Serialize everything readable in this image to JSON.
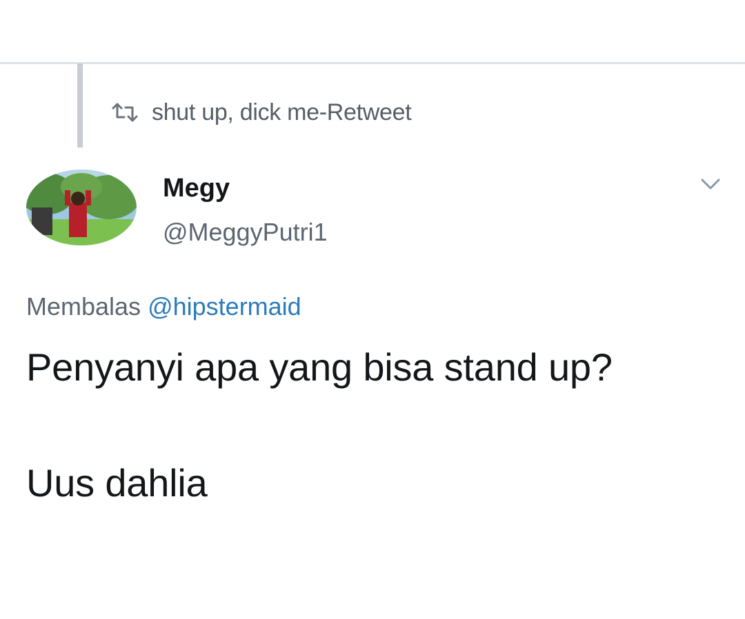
{
  "retweet": {
    "icon": "retweet-icon",
    "text": "shut up, dick me-Retweet"
  },
  "author": {
    "name": "Megy",
    "handle": "@MeggyPutri1",
    "avatar_icon": "avatar-photo"
  },
  "menu": {
    "icon": "chevron-down-icon"
  },
  "reply": {
    "prefix": "Membalas",
    "handle": "@hipstermaid"
  },
  "tweet": {
    "line1": "Penyanyi apa yang bisa stand up?",
    "line2": "Uus dahlia"
  },
  "colors": {
    "link": "#2b7bb9",
    "text": "#14171a",
    "muted": "#5b6670"
  }
}
